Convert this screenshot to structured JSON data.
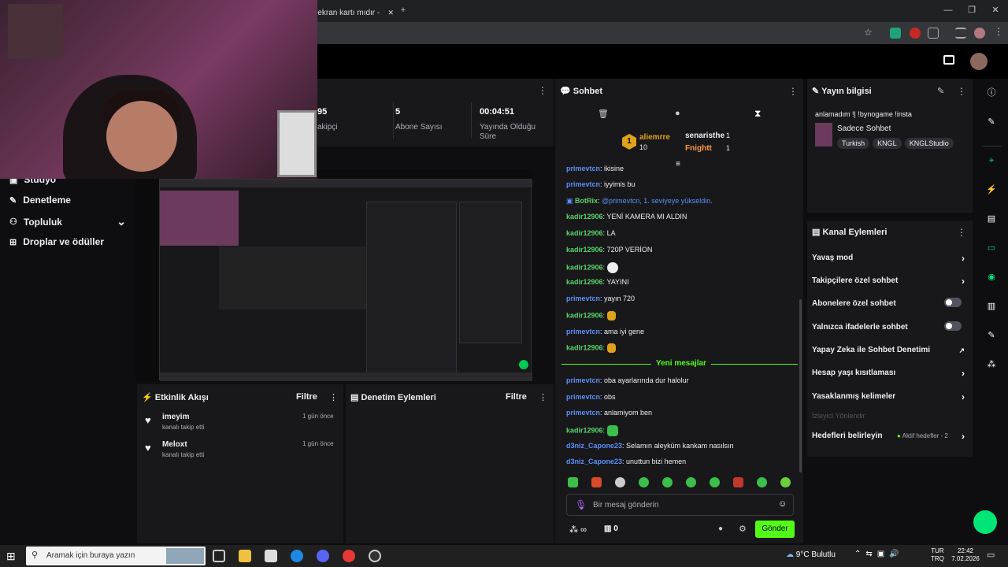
{
  "browser": {
    "tab_title": "4 ekran kartı mıdır -",
    "tab_close": "✕",
    "new_tab": "+",
    "window_min": "—",
    "window_max": "❐",
    "window_close": "✕"
  },
  "stats": [
    {
      "value": "95",
      "label": "akipçi"
    },
    {
      "value": "5",
      "label": "Abone Sayısı"
    },
    {
      "value": "00:04:51",
      "label": "Yayında Olduğu Süre"
    }
  ],
  "leftnav": [
    {
      "label": "Stüdyo",
      "icon": "studio-icon"
    },
    {
      "label": "Denetleme",
      "icon": "wrench-icon"
    },
    {
      "label": "Topluluk",
      "icon": "community-icon",
      "chevron": "⌄"
    },
    {
      "label": "Droplar ve ödüller",
      "icon": "drops-icon"
    }
  ],
  "activity": {
    "title": "Etkinlik Akışı",
    "filter": "Filtre",
    "items": [
      {
        "user": "imeyim",
        "action": "kanalı takip etti",
        "time": "1 gün önce"
      },
      {
        "user": "Meloxt",
        "action": "kanalı takip etti",
        "time": "1 gün önce"
      }
    ]
  },
  "moderation": {
    "title": "Denetim Eylemleri",
    "filter": "Filtre"
  },
  "chat": {
    "title": "Sohbet",
    "leaderboard": {
      "first_rank": "1",
      "first_user": "aliemrre",
      "first_count": "10",
      "second_user": "senaristhe",
      "second_count": "1",
      "third_user": "Fnightt",
      "third_count": "1"
    },
    "messages": [
      {
        "user": "primevtcn",
        "text": "ikisine"
      },
      {
        "user": "primevtcn",
        "text": "iyyimis bu"
      },
      {
        "user": "BotRix",
        "text": "@primevtcn, 1. seviyeye yükseldin."
      },
      {
        "user": "kadir12906",
        "text": "YENİ KAMERA MI ALDIN"
      },
      {
        "user": "kadir12906",
        "text": "LA"
      },
      {
        "user": "kadir12906",
        "text": "720P VERİON"
      },
      {
        "user": "kadir12906",
        "text": ""
      },
      {
        "user": "kadir12906",
        "text": "YAYINI"
      },
      {
        "user": "primevtcn",
        "text": "yayın 720"
      },
      {
        "user": "kadir12906",
        "text": ""
      },
      {
        "user": "primevtcn",
        "text": "ama iyi gene"
      },
      {
        "user": "kadir12906",
        "text": ""
      }
    ],
    "new_messages_label": "Yeni mesajlar",
    "messages2": [
      {
        "user": "primevtcn",
        "text": "oba ayarlarında dur halolur"
      },
      {
        "user": "primevtcn",
        "text": "obs"
      },
      {
        "user": "primevtcn",
        "text": "anlamiyom ben"
      },
      {
        "user": "kadir12906",
        "text": ""
      },
      {
        "user": "d3niz_Capone23",
        "text": "Selamın aleyküm kankam nasılsın"
      },
      {
        "user": "d3niz_Capone23",
        "text": "unuttun bizi hemen"
      }
    ],
    "input_placeholder": "Bir mesaj gönderin",
    "points": "∞",
    "gift_count": "0",
    "send_label": "Gönder"
  },
  "stream_info": {
    "title": "Yayın bilgisi",
    "stream_title": "anlamadım !| !bynogame !insta",
    "category": "Sadece Sohbet",
    "tags": [
      "Turkish",
      "KNGL",
      "KNGLStudio"
    ]
  },
  "channel_actions": {
    "title": "Kanal Eylemleri",
    "items": [
      {
        "label": "Yavaş mod",
        "control": "arrow"
      },
      {
        "label": "Takipçilere özel sohbet",
        "control": "arrow"
      },
      {
        "label": "Abonelere özel sohbet",
        "control": "toggle"
      },
      {
        "label": "Yalnızca ifadelerle sohbet",
        "control": "toggle"
      },
      {
        "label": "Yapay Zeka ile Sohbet Denetimi",
        "control": "external"
      },
      {
        "label": "Hesap yaşı kısıtlaması",
        "control": "arrow"
      },
      {
        "label": "Yasaklanmış kelimeler",
        "control": "arrow"
      },
      {
        "label": "İzleyici Yönlendir",
        "control": "none"
      },
      {
        "label": "Hedefleri belirleyin",
        "control": "arrow",
        "extra": "Aktif hedefler - 2"
      }
    ]
  },
  "taskbar": {
    "search_placeholder": "Aramak için buraya yazın",
    "weather": "9°C Bulutlu",
    "lang": "TUR",
    "lang2": "TRQ",
    "time": "22:42",
    "date": "7.02.2026"
  },
  "colors": {
    "accent": "#53fc18",
    "panel": "#18181b",
    "link_blue": "#5b8ff9",
    "user_green": "#59d26a"
  }
}
